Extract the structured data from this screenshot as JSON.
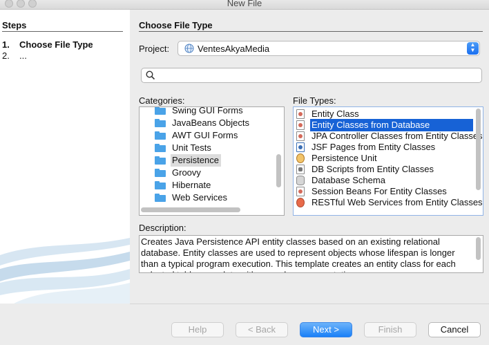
{
  "window": {
    "title": "New File"
  },
  "steps": {
    "heading": "Steps",
    "items": [
      {
        "num": "1.",
        "label": "Choose File Type"
      },
      {
        "num": "2.",
        "label": "..."
      }
    ]
  },
  "section": {
    "title": "Choose File Type"
  },
  "project": {
    "label": "Project:",
    "value": "VentesAkyaMedia"
  },
  "search": {
    "value": ""
  },
  "categories": {
    "label": "Categories:",
    "items": [
      "Swing GUI Forms",
      "JavaBeans Objects",
      "AWT GUI Forms",
      "Unit Tests",
      "Persistence",
      "Groovy",
      "Hibernate",
      "Web Services"
    ],
    "selected": "Persistence"
  },
  "file_types": {
    "label": "File Types:",
    "items": [
      "Entity Class",
      "Entity Classes from Database",
      "JPA Controller Classes from Entity Classes",
      "JSF Pages from Entity Classes",
      "Persistence Unit",
      "DB Scripts from Entity Classes",
      "Database Schema",
      "Session Beans For Entity Classes",
      "RESTful Web Services from Entity Classes"
    ],
    "selected": "Entity Classes from Database"
  },
  "description": {
    "label": "Description:",
    "text": "Creates Java Persistence API entity classes based on an existing relational database. Entity classes are used to represent objects whose lifespan is longer than a typical program execution. This template creates an entity class for each selected table, complete with named query annotations"
  },
  "buttons": {
    "help": "Help",
    "back": "< Back",
    "next": "Next >",
    "finish": "Finish",
    "cancel": "Cancel"
  },
  "colors": {
    "selection": "#1762d6",
    "primary_button": "#1a80f7"
  }
}
